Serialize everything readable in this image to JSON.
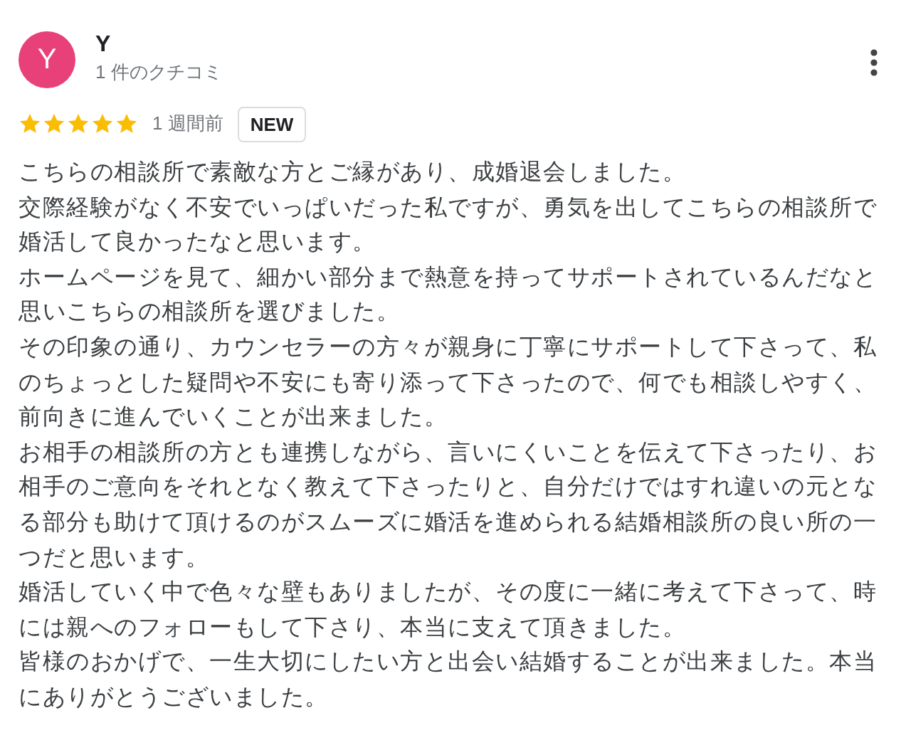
{
  "reviewer": {
    "avatar_letter": "Y",
    "name": "Y",
    "review_count": "1 件のクチコミ"
  },
  "review": {
    "stars": 5,
    "time": "1 週間前",
    "badge": "NEW",
    "paragraphs": [
      "こちらの相談所で素敵な方とご縁があり、成婚退会しました。",
      "交際経験がなく不安でいっぱいだった私ですが、勇気を出してこちらの相談所で婚活して良かったなと思います。",
      "ホームページを見て、細かい部分まで熱意を持ってサポートされているんだなと思いこちらの相談所を選びました。",
      "その印象の通り、カウンセラーの方々が親身に丁寧にサポートして下さって、私のちょっとした疑問や不安にも寄り添って下さったので、何でも相談しやすく、前向きに進んでいくことが出来ました。",
      "お相手の相談所の方とも連携しながら、言いにくいことを伝えて下さったり、お相手のご意向をそれとなく教えて下さったりと、自分だけではすれ違いの元となる部分も助けて頂けるのがスムーズに婚活を進められる結婚相談所の良い所の一つだと思います。",
      "婚活していく中で色々な壁もありましたが、その度に一緒に考えて下さって、時には親へのフォローもして下さり、本当に支えて頂きました。",
      "皆様のおかげで、一生大切にしたい方と出会い結婚することが出来ました。本当にありがとうございました。"
    ]
  }
}
